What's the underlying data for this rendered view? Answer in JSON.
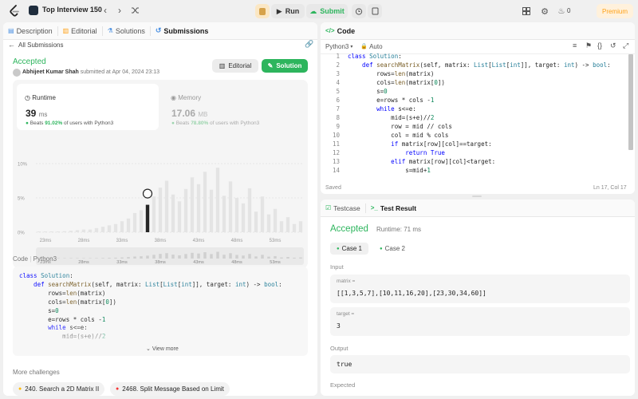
{
  "topbar": {
    "title": "Top Interview 150",
    "run_label": "Run",
    "submit_label": "Submit",
    "streak_count": "0",
    "premium_label": "Premium"
  },
  "left_tabs": [
    {
      "label": "Description"
    },
    {
      "label": "Editorial"
    },
    {
      "label": "Solutions"
    },
    {
      "label": "Submissions"
    }
  ],
  "submission": {
    "back_label": "All Submissions",
    "status": "Accepted",
    "user": "Abhijeet Kumar Shah",
    "submitted_text": "submitted at Apr 04, 2024 23:13",
    "editorial_button": "Editorial",
    "solution_button": "Solution",
    "runtime_label": "Runtime",
    "runtime_value": "39",
    "runtime_unit": "ms",
    "runtime_beats_prefix": "Beats",
    "runtime_beats_pct": "91.02%",
    "runtime_beats_suffix": "of users with Python3",
    "memory_label": "Memory",
    "memory_value": "17.06",
    "memory_unit": "MB",
    "memory_beats_prefix": "Beats",
    "memory_beats_pct": "78.80%",
    "memory_beats_suffix": "of users with Python3"
  },
  "chart_data": {
    "type": "bar",
    "title": "",
    "ylim": [
      0,
      10
    ],
    "yticks": [
      "10%",
      "5%",
      "0%"
    ],
    "xticks": [
      "23ms",
      "28ms",
      "33ms",
      "38ms",
      "43ms",
      "48ms",
      "53ms"
    ],
    "values": [
      0.1,
      0.1,
      0.1,
      0.1,
      0.15,
      0.2,
      0.3,
      0.4,
      0.4,
      0.6,
      0.8,
      1.0,
      1.2,
      1.6,
      2.0,
      2.8,
      3.2,
      4.0,
      5.2,
      6.5,
      7.5,
      5.5,
      4.5,
      6.3,
      8.0,
      7.0,
      8.8,
      6.2,
      9.4,
      5.3,
      7.4,
      5.0,
      4.2,
      6.4,
      3.0,
      5.2,
      2.6,
      3.4,
      1.6,
      2.2,
      1.2,
      1.6
    ],
    "highlight_index": 17
  },
  "minimap": {
    "xticks": [
      "23ms",
      "28ms",
      "33ms",
      "38ms",
      "43ms",
      "48ms",
      "53ms"
    ]
  },
  "code_preview": {
    "header_label": "Code",
    "language": "Python3",
    "view_more": "View more",
    "lines": [
      [
        {
          "t": "class ",
          "c": "kw"
        },
        {
          "t": "Solution",
          "c": "cl"
        },
        {
          "t": ":",
          "c": "pl"
        }
      ],
      [
        {
          "t": "    def ",
          "c": "kw"
        },
        {
          "t": "searchMatrix",
          "c": "fn"
        },
        {
          "t": "(self, matrix: ",
          "c": "pl"
        },
        {
          "t": "List",
          "c": "ty"
        },
        {
          "t": "[",
          "c": "pl"
        },
        {
          "t": "List",
          "c": "ty"
        },
        {
          "t": "[",
          "c": "pl"
        },
        {
          "t": "int",
          "c": "ty"
        },
        {
          "t": "]], target: ",
          "c": "pl"
        },
        {
          "t": "int",
          "c": "ty"
        },
        {
          "t": ") -> ",
          "c": "pl"
        },
        {
          "t": "bool",
          "c": "ty"
        },
        {
          "t": ":",
          "c": "pl"
        }
      ],
      [
        {
          "t": "        rows=",
          "c": "pl"
        },
        {
          "t": "len",
          "c": "fn"
        },
        {
          "t": "(matrix)",
          "c": "pl"
        }
      ],
      [
        {
          "t": "        cols=",
          "c": "pl"
        },
        {
          "t": "len",
          "c": "fn"
        },
        {
          "t": "(matrix[",
          "c": "pl"
        },
        {
          "t": "0",
          "c": "nm"
        },
        {
          "t": "])",
          "c": "pl"
        }
      ],
      [
        {
          "t": "        s=",
          "c": "pl"
        },
        {
          "t": "0",
          "c": "nm"
        }
      ],
      [
        {
          "t": "        e=rows * cols -",
          "c": "pl"
        },
        {
          "t": "1",
          "c": "nm"
        }
      ],
      [
        {
          "t": "        while ",
          "c": "kw"
        },
        {
          "t": "s<=e:",
          "c": "pl"
        }
      ],
      [
        {
          "t": "            mid=(s+e)//",
          "c": "pl"
        },
        {
          "t": "2",
          "c": "nm"
        }
      ]
    ]
  },
  "more_challenges": {
    "label": "More challenges",
    "items": [
      {
        "label": "240. Search a 2D Matrix II",
        "color": "#ffb800"
      },
      {
        "label": "2468. Split Message Based on Limit",
        "color": "#f63636"
      }
    ]
  },
  "code_panel": {
    "title": "Code",
    "language": "Python3",
    "auto_label": "Auto",
    "saved_label": "Saved",
    "cursor_pos": "Ln 17, Col 17",
    "lines": [
      {
        "n": "1",
        "toks": [
          {
            "t": "class ",
            "c": "kw"
          },
          {
            "t": "Solution",
            "c": "cl"
          },
          {
            "t": ":",
            "c": "pl"
          }
        ]
      },
      {
        "n": "2",
        "toks": [
          {
            "t": "    def ",
            "c": "kw"
          },
          {
            "t": "searchMatrix",
            "c": "fn"
          },
          {
            "t": "(self, matrix: ",
            "c": "pl"
          },
          {
            "t": "List",
            "c": "ty"
          },
          {
            "t": "[",
            "c": "pl"
          },
          {
            "t": "List",
            "c": "ty"
          },
          {
            "t": "[",
            "c": "pl"
          },
          {
            "t": "int",
            "c": "ty"
          },
          {
            "t": "]], target: ",
            "c": "pl"
          },
          {
            "t": "int",
            "c": "ty"
          },
          {
            "t": ") -> ",
            "c": "pl"
          },
          {
            "t": "bool",
            "c": "ty"
          },
          {
            "t": ":",
            "c": "pl"
          }
        ]
      },
      {
        "n": "3",
        "toks": [
          {
            "t": "        rows=",
            "c": "pl"
          },
          {
            "t": "len",
            "c": "fn"
          },
          {
            "t": "(matrix)",
            "c": "pl"
          }
        ]
      },
      {
        "n": "4",
        "toks": [
          {
            "t": "        cols=",
            "c": "pl"
          },
          {
            "t": "len",
            "c": "fn"
          },
          {
            "t": "(matrix[",
            "c": "pl"
          },
          {
            "t": "0",
            "c": "nm"
          },
          {
            "t": "])",
            "c": "pl"
          }
        ]
      },
      {
        "n": "5",
        "toks": [
          {
            "t": "        s=",
            "c": "pl"
          },
          {
            "t": "0",
            "c": "nm"
          }
        ]
      },
      {
        "n": "6",
        "toks": [
          {
            "t": "        e=rows * cols -",
            "c": "pl"
          },
          {
            "t": "1",
            "c": "nm"
          }
        ]
      },
      {
        "n": "7",
        "toks": [
          {
            "t": "        while ",
            "c": "kw"
          },
          {
            "t": "s<=e:",
            "c": "pl"
          }
        ]
      },
      {
        "n": "8",
        "toks": [
          {
            "t": "            mid=(s+e)//",
            "c": "pl"
          },
          {
            "t": "2",
            "c": "nm"
          }
        ]
      },
      {
        "n": "9",
        "toks": [
          {
            "t": "            row = mid // cols",
            "c": "pl"
          }
        ]
      },
      {
        "n": "10",
        "toks": [
          {
            "t": "            col = mid % cols",
            "c": "pl"
          }
        ]
      },
      {
        "n": "11",
        "toks": [
          {
            "t": "            if ",
            "c": "kw"
          },
          {
            "t": "matrix[row][col]==target:",
            "c": "pl"
          }
        ]
      },
      {
        "n": "12",
        "toks": [
          {
            "t": "                return ",
            "c": "kw"
          },
          {
            "t": "True",
            "c": "kw"
          }
        ]
      },
      {
        "n": "13",
        "toks": [
          {
            "t": "            elif ",
            "c": "kw"
          },
          {
            "t": "matrix[row][col]<target:",
            "c": "pl"
          }
        ]
      },
      {
        "n": "14",
        "toks": [
          {
            "t": "                s=mid+",
            "c": "pl"
          },
          {
            "t": "1",
            "c": "nm"
          }
        ]
      }
    ]
  },
  "test_panel": {
    "testcase_tab": "Testcase",
    "result_tab": "Test Result",
    "status": "Accepted",
    "runtime_text": "Runtime: 71 ms",
    "case1": "Case 1",
    "case2": "Case 2",
    "input_label": "Input",
    "matrix_label": "matrix =",
    "matrix_value": "[[1,3,5,7],[10,11,16,20],[23,30,34,60]]",
    "target_label": "target =",
    "target_value": "3",
    "output_label": "Output",
    "output_value": "true",
    "expected_label": "Expected"
  },
  "colors": {
    "accepted": "#2db55d",
    "accent_green": "#2db55d",
    "premium": "#ffa116"
  }
}
